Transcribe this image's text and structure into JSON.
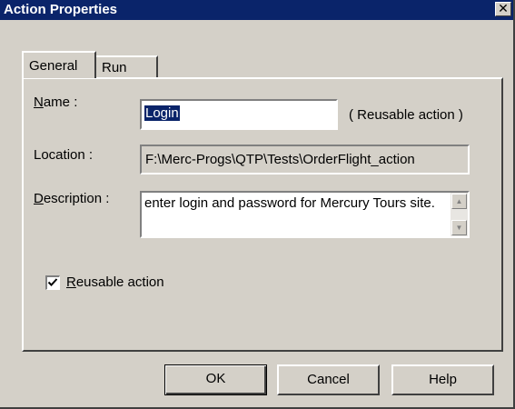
{
  "window": {
    "title": "Action Properties",
    "close_glyph": "✕"
  },
  "tabs": [
    {
      "label": "General"
    },
    {
      "label": "Run"
    }
  ],
  "form": {
    "name_label": {
      "access": "N",
      "rest": "ame :"
    },
    "name_value": "Login",
    "reusable_note": "( Reusable action )",
    "location_label": "Location :",
    "location_value": "F:\\Merc-Progs\\QTP\\Tests\\OrderFlight_action",
    "description_label": {
      "access": "D",
      "rest": "escription :"
    },
    "description_value": "enter login and password for Mercury Tours site.",
    "reusable_checkbox": {
      "access": "R",
      "rest": "eusable action",
      "checked": true
    }
  },
  "buttons": {
    "ok": "OK",
    "cancel": "Cancel",
    "help": "Help"
  },
  "colors": {
    "titlebar": "#0a246a",
    "face": "#d4d0c8",
    "selection": "#0a246a"
  },
  "icons": {
    "close": "close-icon",
    "scroll_up": "arrow-up-icon",
    "scroll_down": "arrow-down-icon",
    "check": "checkmark-icon"
  }
}
